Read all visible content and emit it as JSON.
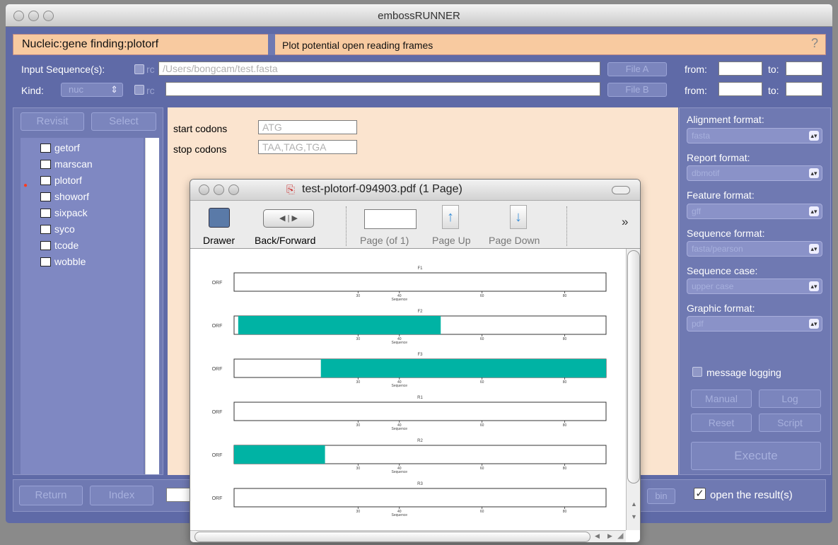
{
  "window": {
    "title": "embossRUNNER"
  },
  "header": {
    "path": "Nucleic:gene finding:plotorf",
    "description": "Plot potential open reading frames",
    "help": "?"
  },
  "input": {
    "seq_label": "Input Sequence(s):",
    "rc": "rc",
    "seq_value": "/Users/bongcam/test.fasta",
    "file_a": "File A",
    "from": "from:",
    "to": "to:",
    "kind_label": "Kind:",
    "kind_value": "nuc",
    "file_b": "File B"
  },
  "left": {
    "revisit": "Revisit",
    "select": "Select",
    "items": [
      "getorf",
      "marscan",
      "plotorf",
      "showorf",
      "sixpack",
      "syco",
      "tcode",
      "wobble"
    ]
  },
  "center": {
    "start_label": "start codons",
    "start_value": "ATG",
    "stop_label": "stop codons",
    "stop_value": "TAA,TAG,TGA"
  },
  "right": {
    "align_label": "Alignment format:",
    "align_value": "fasta",
    "report_label": "Report format:",
    "report_value": "dbmotif",
    "feature_label": "Feature format:",
    "feature_value": "gff",
    "seqfmt_label": "Sequence format:",
    "seqfmt_value": "fasta/pearson",
    "case_label": "Sequence case:",
    "case_value": "upper case",
    "graphic_label": "Graphic format:",
    "graphic_value": "pdf",
    "logging": "message logging",
    "manual": "Manual",
    "log": "Log",
    "reset": "Reset",
    "script": "Script",
    "execute": "Execute"
  },
  "bottom": {
    "return": "Return",
    "index": "Index",
    "open_results": "open the result(s)",
    "partial_btn": "bin"
  },
  "pdf": {
    "title": "test-plotorf-094903.pdf (1 Page)",
    "drawer": "Drawer",
    "backforward": "Back/Forward",
    "page_of": "Page (of 1)",
    "page_up": "Page Up",
    "page_down": "Page Down",
    "more": "»"
  },
  "colors": {
    "accent": "#00b3a4",
    "panel": "#6f79b2",
    "header": "#f8caa0"
  },
  "chart_data": {
    "type": "bar",
    "axis_label": "Sequence",
    "y_label": "ORF",
    "ticks": [
      30,
      40,
      60,
      80
    ],
    "frames": [
      {
        "name": "F1",
        "orf": null
      },
      {
        "name": "F2",
        "orf": [
          1,
          50
        ]
      },
      {
        "name": "F3",
        "orf": [
          21,
          90
        ]
      },
      {
        "name": "R1",
        "orf": null
      },
      {
        "name": "R2",
        "orf": [
          0,
          22
        ]
      },
      {
        "name": "R3",
        "orf": null
      }
    ],
    "xlim": [
      0,
      90
    ]
  }
}
